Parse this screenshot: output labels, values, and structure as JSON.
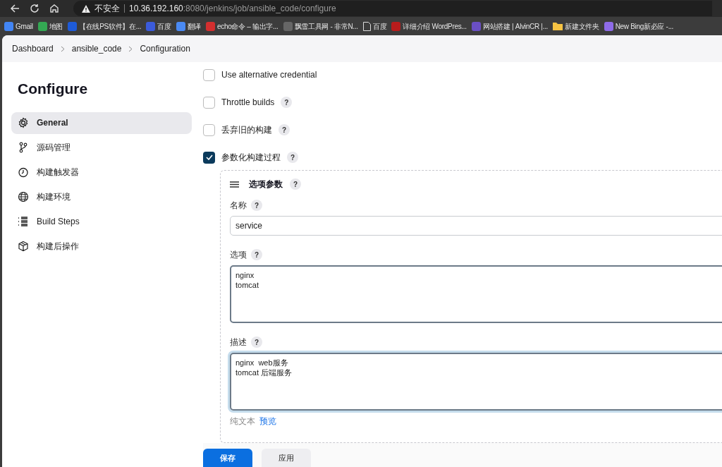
{
  "browser": {
    "address": {
      "warning": "不安全",
      "host": "10.36.192.160",
      "path": ":8080/jenkins/job/ansible_code/configure"
    },
    "bookmarks": [
      {
        "label": "Gmail",
        "kind": "site",
        "color": "#4285f4"
      },
      {
        "label": "地图",
        "kind": "site",
        "color": "#34a853"
      },
      {
        "label": "【在线PS软件】在...",
        "kind": "site",
        "color": "#1e5bd8"
      },
      {
        "label": "百度",
        "kind": "site",
        "color": "#3b5bdb"
      },
      {
        "label": "翻译",
        "kind": "site",
        "color": "#4a8af4"
      },
      {
        "label": "echo命令 – 输出字...",
        "kind": "site",
        "color": "#d32f2f"
      },
      {
        "label": "飘雪工具网 - 非常N...",
        "kind": "site",
        "color": "#666666"
      },
      {
        "label": "百度",
        "kind": "page",
        "color": "#dddddd"
      },
      {
        "label": "详细介绍 WordPres...",
        "kind": "site",
        "color": "#b71c1c"
      },
      {
        "label": "网站搭建 | AlvinCR |...",
        "kind": "site",
        "color": "#6a4fc4"
      },
      {
        "label": "新建文件夹",
        "kind": "folder",
        "color": "#f6c343"
      },
      {
        "label": "New Bing新必应 -...",
        "kind": "site",
        "color": "#8e6be8"
      }
    ]
  },
  "breadcrumb": [
    "Dashboard",
    "ansible_code",
    "Configuration"
  ],
  "sidebar": {
    "title": "Configure",
    "items": [
      {
        "label": "General",
        "kind": "gear",
        "selected": true
      },
      {
        "label": "源码管理",
        "kind": "branch",
        "selected": false
      },
      {
        "label": "构建触发器",
        "kind": "clock",
        "selected": false
      },
      {
        "label": "构建环境",
        "kind": "globe",
        "selected": false
      },
      {
        "label": "Build Steps",
        "kind": "list",
        "selected": false
      },
      {
        "label": "构建后操作",
        "kind": "box",
        "selected": false
      }
    ]
  },
  "options": [
    {
      "label": "Use alternative credential",
      "checked": false
    },
    {
      "label": "Throttle builds",
      "help": "?",
      "checked": false
    },
    {
      "label": "丢弃旧的构建",
      "help": "?",
      "checked": false
    },
    {
      "label": "参数化构建过程",
      "help": "?",
      "checked": true
    }
  ],
  "parameter": {
    "title": "选项参数",
    "help": "?",
    "fields": [
      {
        "label": "名称",
        "help": "?",
        "kind": "input",
        "value": "service",
        "focused": false
      },
      {
        "label": "选项",
        "help": "?",
        "kind": "textarea",
        "value": "nginx\ntomcat",
        "focused": false
      },
      {
        "label": "描述",
        "help": "?",
        "kind": "textarea",
        "value": "nginx  web服务\ntomcat 后端服务",
        "focused": true
      }
    ],
    "format": {
      "label": "纯文本",
      "link": "预览"
    }
  },
  "buttons": [
    {
      "label": "保存",
      "kind": "primary"
    },
    {
      "label": "应用",
      "kind": "secondary"
    }
  ]
}
